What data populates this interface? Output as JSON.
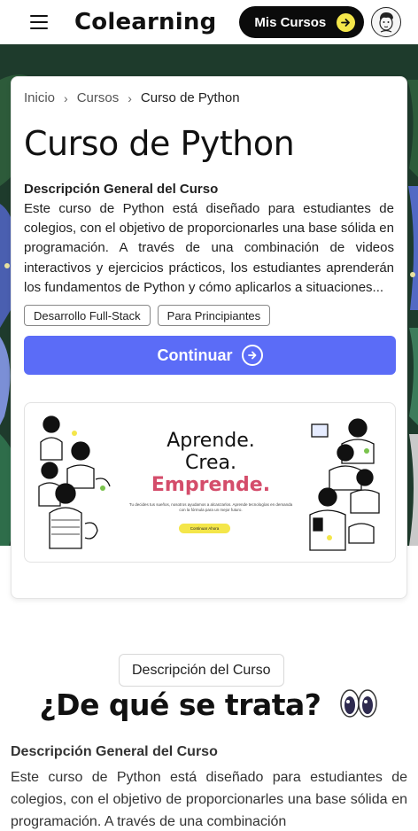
{
  "header": {
    "brand": "Colearning",
    "my_courses_label": "Mis Cursos"
  },
  "breadcrumb": [
    {
      "label": "Inicio"
    },
    {
      "label": "Cursos"
    },
    {
      "label": "Curso de Python"
    }
  ],
  "course": {
    "title": "Curso de Python",
    "description_heading": "Descripción General del Curso",
    "description": "Este curso de Python está diseñado para estudiantes de colegios, con el objetivo de proporcionarles una base sólida en programación. A través de una combinación de videos interactivos y ejercicios prácticos, los estudiantes aprenderán los fundamentos de Python y cómo aplicarlos a situaciones...",
    "tags": [
      "Desarrollo Full-Stack",
      "Para Principiantes"
    ],
    "continue_label": "Continuar"
  },
  "banner": {
    "line1": "Aprende.",
    "line2": "Crea.",
    "line3": "Emprende.",
    "subtitle": "Tu decides tus sueños, nosotros ayudamos a alcanzarlos. Aprende tecnologías en demanda con la fórmula para un mejor futuro.",
    "button_label": "Continuar Ahora",
    "accent_color": "#d44d6b"
  },
  "section": {
    "badge": "Descripción del Curso",
    "title": "¿De qué se trata?",
    "description_heading": "Descripción General del Curso",
    "description": "Este curso de Python está diseñado para estudiantes de colegios, con el objetivo de proporcionarles una base sólida en programación. A través de una combinación"
  },
  "colors": {
    "primary_button": "#5b6cf7",
    "header_button": "#0b0b0b",
    "arrow_accent": "#f4e64a"
  },
  "icons": {
    "menu": "menu-icon",
    "arrow": "arrow-right-icon",
    "avatar": "avatar-icon",
    "chevron": "chevron-right-icon",
    "eyes": "eyes-icon"
  }
}
